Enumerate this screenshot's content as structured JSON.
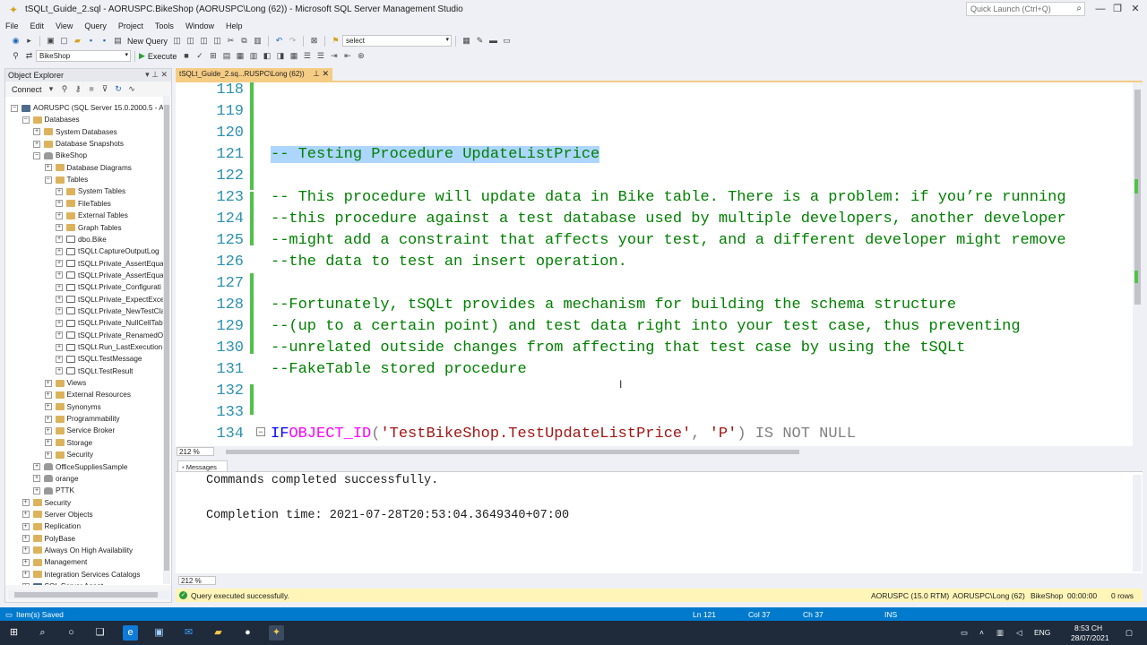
{
  "window": {
    "title": "tSQLt_Guide_2.sql - AORUSPC.BikeShop (AORUSPC\\Long (62)) - Microsoft SQL Server Management Studio",
    "quick_launch_placeholder": "Quick Launch (Ctrl+Q)"
  },
  "menu": [
    "File",
    "Edit",
    "View",
    "Query",
    "Project",
    "Tools",
    "Window",
    "Help"
  ],
  "toolbar": {
    "new_query": "New Query",
    "search_combo": "select",
    "database_combo": "BikeShop",
    "execute": "Execute"
  },
  "object_explorer": {
    "title": "Object Explorer",
    "connect": "Connect",
    "nodes": [
      {
        "label": "AORUSPC (SQL Server 15.0.2000.5 - A",
        "level": 0,
        "exp": "-",
        "icon": "srv"
      },
      {
        "label": "Databases",
        "level": 1,
        "exp": "-",
        "icon": "fold"
      },
      {
        "label": "System Databases",
        "level": 2,
        "exp": "+",
        "icon": "fold"
      },
      {
        "label": "Database Snapshots",
        "level": 2,
        "exp": "+",
        "icon": "fold"
      },
      {
        "label": "BikeShop",
        "level": 2,
        "exp": "-",
        "icon": "db"
      },
      {
        "label": "Database Diagrams",
        "level": 3,
        "exp": "+",
        "icon": "fold"
      },
      {
        "label": "Tables",
        "level": 3,
        "exp": "-",
        "icon": "fold"
      },
      {
        "label": "System Tables",
        "level": 4,
        "exp": "+",
        "icon": "fold"
      },
      {
        "label": "FileTables",
        "level": 4,
        "exp": "+",
        "icon": "fold"
      },
      {
        "label": "External Tables",
        "level": 4,
        "exp": "+",
        "icon": "fold"
      },
      {
        "label": "Graph Tables",
        "level": 4,
        "exp": "+",
        "icon": "fold"
      },
      {
        "label": "dbo.Bike",
        "level": 4,
        "exp": "+",
        "icon": "tbl"
      },
      {
        "label": "tSQLt.CaptureOutputLog",
        "level": 4,
        "exp": "+",
        "icon": "tbl"
      },
      {
        "label": "tSQLt.Private_AssertEqua",
        "level": 4,
        "exp": "+",
        "icon": "tbl"
      },
      {
        "label": "tSQLt.Private_AssertEqua",
        "level": 4,
        "exp": "+",
        "icon": "tbl"
      },
      {
        "label": "tSQLt.Private_Configurati",
        "level": 4,
        "exp": "+",
        "icon": "tbl"
      },
      {
        "label": "tSQLt.Private_ExpectExce",
        "level": 4,
        "exp": "+",
        "icon": "tbl"
      },
      {
        "label": "tSQLt.Private_NewTestCla",
        "level": 4,
        "exp": "+",
        "icon": "tbl"
      },
      {
        "label": "tSQLt.Private_NullCellTab",
        "level": 4,
        "exp": "+",
        "icon": "tbl"
      },
      {
        "label": "tSQLt.Private_RenamedO",
        "level": 4,
        "exp": "+",
        "icon": "tbl"
      },
      {
        "label": "tSQLt.Run_LastExecution",
        "level": 4,
        "exp": "+",
        "icon": "tbl"
      },
      {
        "label": "tSQLt.TestMessage",
        "level": 4,
        "exp": "+",
        "icon": "tbl"
      },
      {
        "label": "tSQLt.TestResult",
        "level": 4,
        "exp": "+",
        "icon": "tbl"
      },
      {
        "label": "Views",
        "level": 3,
        "exp": "+",
        "icon": "fold"
      },
      {
        "label": "External Resources",
        "level": 3,
        "exp": "+",
        "icon": "fold"
      },
      {
        "label": "Synonyms",
        "level": 3,
        "exp": "+",
        "icon": "fold"
      },
      {
        "label": "Programmability",
        "level": 3,
        "exp": "+",
        "icon": "fold"
      },
      {
        "label": "Service Broker",
        "level": 3,
        "exp": "+",
        "icon": "fold"
      },
      {
        "label": "Storage",
        "level": 3,
        "exp": "+",
        "icon": "fold"
      },
      {
        "label": "Security",
        "level": 3,
        "exp": "+",
        "icon": "fold"
      },
      {
        "label": "OfficeSuppliesSample",
        "level": 2,
        "exp": "+",
        "icon": "db"
      },
      {
        "label": "orange",
        "level": 2,
        "exp": "+",
        "icon": "db"
      },
      {
        "label": "PTTK",
        "level": 2,
        "exp": "+",
        "icon": "db"
      },
      {
        "label": "Security",
        "level": 1,
        "exp": "+",
        "icon": "fold"
      },
      {
        "label": "Server Objects",
        "level": 1,
        "exp": "+",
        "icon": "fold"
      },
      {
        "label": "Replication",
        "level": 1,
        "exp": "+",
        "icon": "fold"
      },
      {
        "label": "PolyBase",
        "level": 1,
        "exp": "+",
        "icon": "fold"
      },
      {
        "label": "Always On High Availability",
        "level": 1,
        "exp": "+",
        "icon": "fold"
      },
      {
        "label": "Management",
        "level": 1,
        "exp": "+",
        "icon": "fold"
      },
      {
        "label": "Integration Services Catalogs",
        "level": 1,
        "exp": "+",
        "icon": "fold"
      },
      {
        "label": "SQL Server Agent",
        "level": 1,
        "exp": "+",
        "icon": "srv"
      }
    ]
  },
  "doc_tab": {
    "label": "tSQLt_Guide_2.sq...RUSPC\\Long (62))"
  },
  "editor": {
    "zoom": "212 %",
    "lines": [
      {
        "n": "118",
        "t": ""
      },
      {
        "n": "119",
        "t": ""
      },
      {
        "n": "120",
        "t": ""
      },
      {
        "n": "121",
        "t": "-- Testing Procedure UpdateListPrice",
        "sel": true
      },
      {
        "n": "122",
        "t": ""
      },
      {
        "n": "123",
        "t": "-- This procedure will update data in Bike table. There is a problem: if you’re running"
      },
      {
        "n": "124",
        "t": "--this procedure against a test database used by multiple developers, another developer"
      },
      {
        "n": "125",
        "t": "--might add a constraint that affects your test, and a different developer might remove"
      },
      {
        "n": "126",
        "t": "--the data to test an insert operation."
      },
      {
        "n": "127",
        "t": ""
      },
      {
        "n": "128",
        "t": "--Fortunately, tSQLt provides a mechanism for building the schema structure"
      },
      {
        "n": "129",
        "t": "--(up to a certain point) and test data right into your test case, thus preventing"
      },
      {
        "n": "130",
        "t": "--unrelated outside changes from affecting that test case by using the tSQLt"
      },
      {
        "n": "131",
        "t": "--FakeTable stored procedure"
      },
      {
        "n": "132",
        "t": ""
      },
      {
        "n": "133",
        "t": ""
      },
      {
        "n": "134",
        "t": ""
      }
    ],
    "line134": {
      "kw": "IF",
      "fn": "OBJECT_ID",
      "p1": "(",
      "str1": "'TestBikeShop.TestUpdateListPrice'",
      "comma": ", ",
      "str2": "'P'",
      "p2": ")",
      "rest": " IS NOT NULL"
    }
  },
  "messages": {
    "tab": "Messages",
    "line1": "Commands completed successfully.",
    "line2": "Completion time: 2021-07-28T20:53:04.3649340+07:00",
    "zoom": "212 %"
  },
  "query_status": {
    "text": "Query executed successfully.",
    "server": "AORUSPC (15.0 RTM)",
    "user": "AORUSPC\\Long (62)",
    "db": "BikeShop",
    "time": "00:00:00",
    "rows": "0 rows"
  },
  "app_status": {
    "left": "Item(s) Saved",
    "ln": "Ln 121",
    "col": "Col 37",
    "ch": "Ch 37",
    "mode": "INS"
  },
  "taskbar": {
    "lang": "ENG",
    "time": "8:53 CH",
    "date": "28/07/2021"
  }
}
